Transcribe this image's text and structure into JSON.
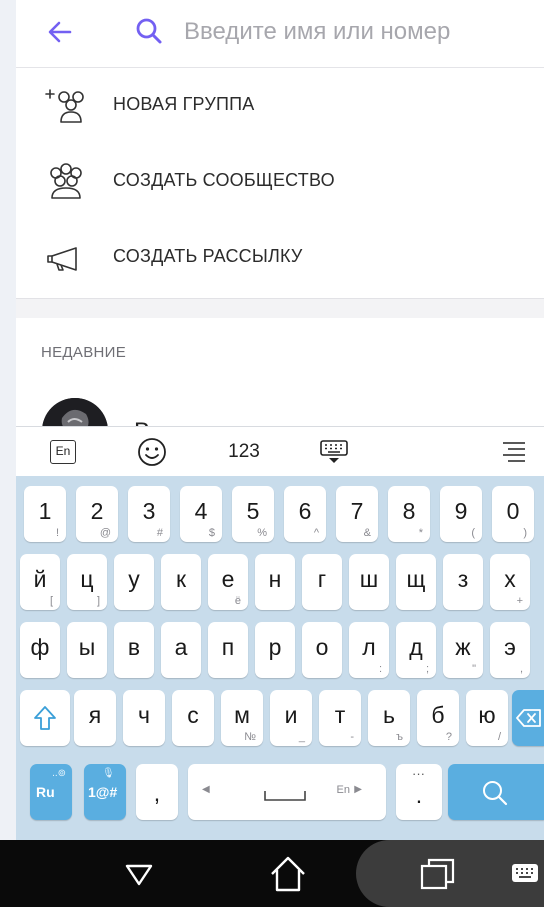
{
  "search": {
    "placeholder": "Введите имя или номер"
  },
  "menu": {
    "items": [
      {
        "label": "НОВАЯ ГРУППА",
        "icon": "add-group-icon"
      },
      {
        "label": "СОЗДАТЬ СООБЩЕСТВО",
        "icon": "community-icon"
      },
      {
        "label": "СОЗДАТЬ РАССЫЛКУ",
        "icon": "broadcast-icon"
      }
    ]
  },
  "recent": {
    "section_label": "НЕДАВНИЕ",
    "contact_name_partial": "В"
  },
  "keyboard": {
    "toolbar": {
      "lang": "En",
      "numeric": "123"
    },
    "number_row": [
      {
        "main": "1",
        "sub": "!"
      },
      {
        "main": "2",
        "sub": "@"
      },
      {
        "main": "3",
        "sub": "#"
      },
      {
        "main": "4",
        "sub": "$"
      },
      {
        "main": "5",
        "sub": "%"
      },
      {
        "main": "6",
        "sub": "^"
      },
      {
        "main": "7",
        "sub": "&"
      },
      {
        "main": "8",
        "sub": "*"
      },
      {
        "main": "9",
        "sub": "("
      },
      {
        "main": "0",
        "sub": ")"
      }
    ],
    "row1": [
      {
        "main": "й",
        "sub": "["
      },
      {
        "main": "ц",
        "sub": "]"
      },
      {
        "main": "у",
        "sub": ""
      },
      {
        "main": "к",
        "sub": ""
      },
      {
        "main": "е",
        "sub": "ё"
      },
      {
        "main": "н",
        "sub": ""
      },
      {
        "main": "г",
        "sub": ""
      },
      {
        "main": "ш",
        "sub": ""
      },
      {
        "main": "щ",
        "sub": ""
      },
      {
        "main": "з",
        "sub": ""
      },
      {
        "main": "х",
        "sub": "+"
      }
    ],
    "row2": [
      {
        "main": "ф",
        "sub": ""
      },
      {
        "main": "ы",
        "sub": ""
      },
      {
        "main": "в",
        "sub": ""
      },
      {
        "main": "а",
        "sub": ""
      },
      {
        "main": "п",
        "sub": ""
      },
      {
        "main": "р",
        "sub": ""
      },
      {
        "main": "о",
        "sub": ""
      },
      {
        "main": "л",
        "sub": ":"
      },
      {
        "main": "д",
        "sub": ";"
      },
      {
        "main": "ж",
        "sub": "\""
      },
      {
        "main": "э",
        "sub": ","
      }
    ],
    "row3": [
      {
        "main": "я",
        "sub": ""
      },
      {
        "main": "ч",
        "sub": ""
      },
      {
        "main": "с",
        "sub": ""
      },
      {
        "main": "м",
        "sub": "№"
      },
      {
        "main": "и",
        "sub": "_"
      },
      {
        "main": "т",
        "sub": "-"
      },
      {
        "main": "ь",
        "sub": "ъ"
      },
      {
        "main": "б",
        "sub": "?"
      },
      {
        "main": "ю",
        "sub": "/"
      }
    ],
    "bottom": {
      "lang_key": "Ru",
      "symbols_key": "1@#",
      "comma": ",",
      "space_lang": "En",
      "period": "."
    }
  },
  "colors": {
    "accent": "#7360f2",
    "keyboard_bg": "#c8dceb",
    "key_blue": "#5aaee0"
  }
}
